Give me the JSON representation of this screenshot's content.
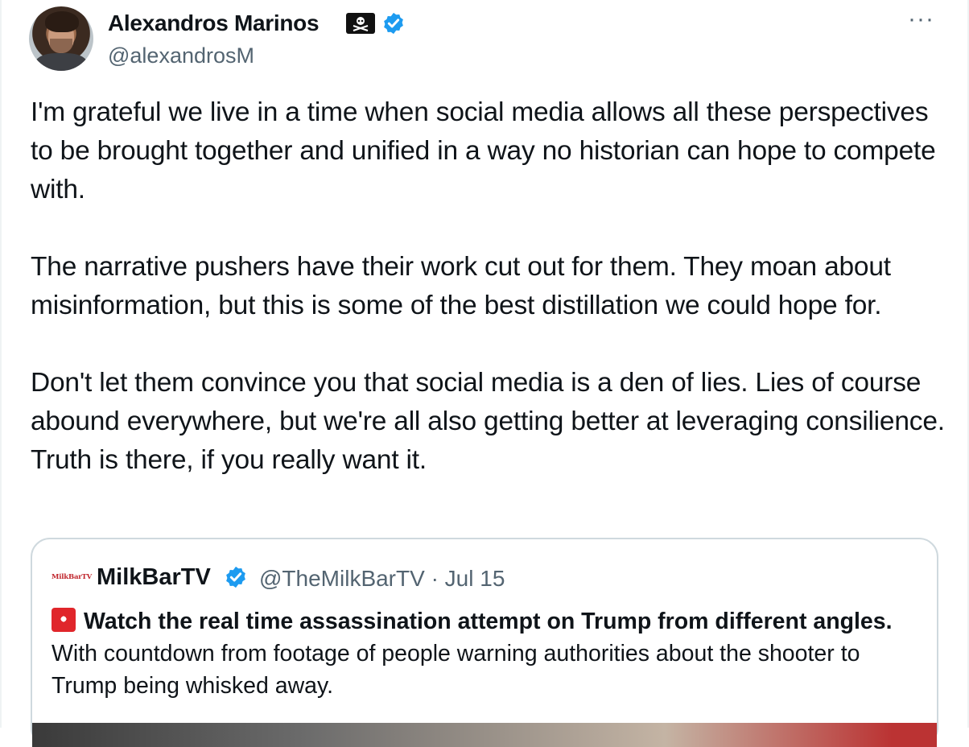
{
  "tweet": {
    "author_name": "Alexandros Marinos",
    "author_handle": "@alexandrosM",
    "more_label": "···",
    "paragraphs": [
      "I'm grateful we live in a time when social media allows all these perspectives to be brought together and unified in a way no historian can hope to compete with.",
      "The narrative pushers have their work cut out for them. They moan about misinformation, but this is some of the best distillation we could hope for.",
      "Don't let them convince you that social media is a den of lies. Lies of course abound everywhere, but we're all also getting better at leveraging consilience. Truth is there, if you really want it."
    ]
  },
  "quoted": {
    "logo_text": "MilkBarTV",
    "name": "MilkBarTV",
    "handle_date": "@TheMilkBarTV · Jul 15",
    "bold_text": "Watch the real time assassination attempt on Trump from different angles.",
    "rest_text": " With countdown from footage of people warning authorities about the shooter to Trump being whisked away."
  },
  "icons": {
    "avatar": "avatar-photo",
    "pirate": "pirate-flag-icon",
    "verified": "verified-badge-icon",
    "siren": "siren-emoji-icon"
  },
  "colors": {
    "verified_blue": "#1d9bf0",
    "muted": "#536471",
    "border": "#cfd9de",
    "logo_red": "#c0262d"
  }
}
